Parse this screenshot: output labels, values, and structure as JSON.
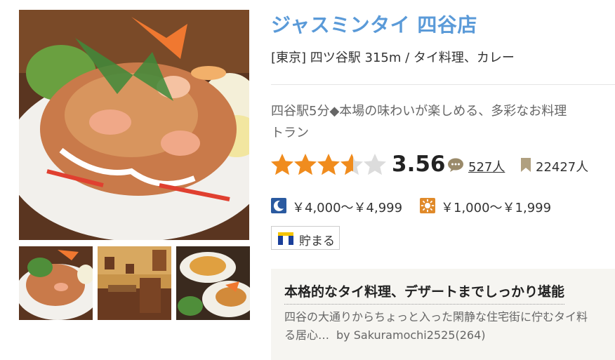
{
  "restaurant": {
    "name": "ジャスミンタイ 四谷店",
    "area": "[東京] 四ツ谷駅 315m / タイ料理、カレー",
    "catch_line1": "四谷駅5分◆本場の味わいが楽しめる、多彩なお料理",
    "catch_line2": "トラン"
  },
  "rating": {
    "score": "3.56",
    "stars_value": 3.56,
    "reviews": "527人",
    "bookmarks": "22427人"
  },
  "price": {
    "dinner": "￥4,000～￥4,999",
    "lunch": "￥1,000～￥1,999"
  },
  "tpoint": {
    "label": "貯まる"
  },
  "review": {
    "title": "本格的なタイ料理、デザートまでしっかり堪能",
    "body_line1": "四谷の大通りからちょっと入った閑静な住宅街に佇むタイ料",
    "body_line2": "る居心…",
    "author": "by Sakuramochi2525(264)"
  },
  "colors": {
    "title": "#5a9ad8",
    "star": "#f08c1e",
    "moon_badge": "#2a5aa0",
    "sun_badge": "#e08a2a"
  },
  "icons": [
    "comment-icon",
    "bookmark-icon",
    "moon-icon",
    "sun-icon",
    "tpoint-logo",
    "star-icon"
  ]
}
